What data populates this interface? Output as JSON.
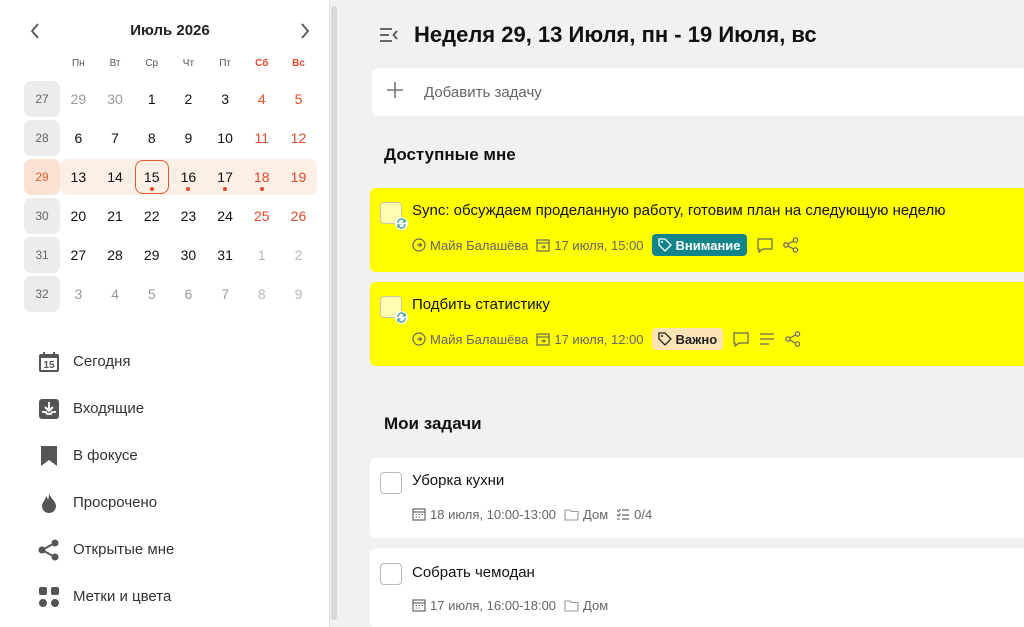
{
  "calendar": {
    "month_title": "Июль 2026",
    "weekdays": [
      "Пн",
      "Вт",
      "Ср",
      "Чт",
      "Пт",
      "Сб",
      "Вс"
    ],
    "weeks": [
      {
        "num": "27",
        "days": [
          "29",
          "30",
          "1",
          "2",
          "3",
          "4",
          "5"
        ]
      },
      {
        "num": "28",
        "days": [
          "6",
          "7",
          "8",
          "9",
          "10",
          "11",
          "12"
        ]
      },
      {
        "num": "29",
        "days": [
          "13",
          "14",
          "15",
          "16",
          "17",
          "18",
          "19"
        ]
      },
      {
        "num": "30",
        "days": [
          "20",
          "21",
          "22",
          "23",
          "24",
          "25",
          "26"
        ]
      },
      {
        "num": "31",
        "days": [
          "27",
          "28",
          "29",
          "30",
          "31",
          "1",
          "2"
        ]
      },
      {
        "num": "32",
        "days": [
          "3",
          "4",
          "5",
          "6",
          "7",
          "8",
          "9"
        ]
      }
    ]
  },
  "menu": [
    {
      "label": "Сегодня",
      "icon": "calendar-today-icon",
      "badge": "15"
    },
    {
      "label": "Входящие",
      "icon": "inbox-icon"
    },
    {
      "label": "В фокусе",
      "icon": "bookmark-icon"
    },
    {
      "label": "Просрочено",
      "icon": "flame-icon"
    },
    {
      "label": "Открытые мне",
      "icon": "share-icon"
    },
    {
      "label": "Метки и цвета",
      "icon": "tags-grid-icon"
    }
  ],
  "main": {
    "week_title": "Неделя 29, 13 Июля, пн - 19 Июля, вс",
    "add_task_label": "Добавить задачу",
    "shared_title": "Доступные мне",
    "mine_title": "Мои задачи"
  },
  "shared_tasks": [
    {
      "title": "Sync: обсуждаем проделанную работу, готовим план на следующую неделю",
      "assignee": "Майя Балашёва",
      "date": "17 июля, 15:00",
      "tag": "Внимание"
    },
    {
      "title": "Подбить статистику",
      "assignee": "Майя Балашёва",
      "date": "17 июля, 12:00",
      "tag": "Важно"
    }
  ],
  "my_tasks": [
    {
      "title": "Уборка кухни",
      "date": "18 июля, 10:00-13:00",
      "project": "Дом",
      "checklist": "0/4"
    },
    {
      "title": "Собрать чемодан",
      "date": "17 июля, 16:00-18:00",
      "project": "Дом"
    }
  ],
  "colors": {
    "accent": "#e24a2a",
    "highlight": "#ffff00",
    "tag_teal": "#12858a",
    "tag_orange": "#fde4b4"
  }
}
